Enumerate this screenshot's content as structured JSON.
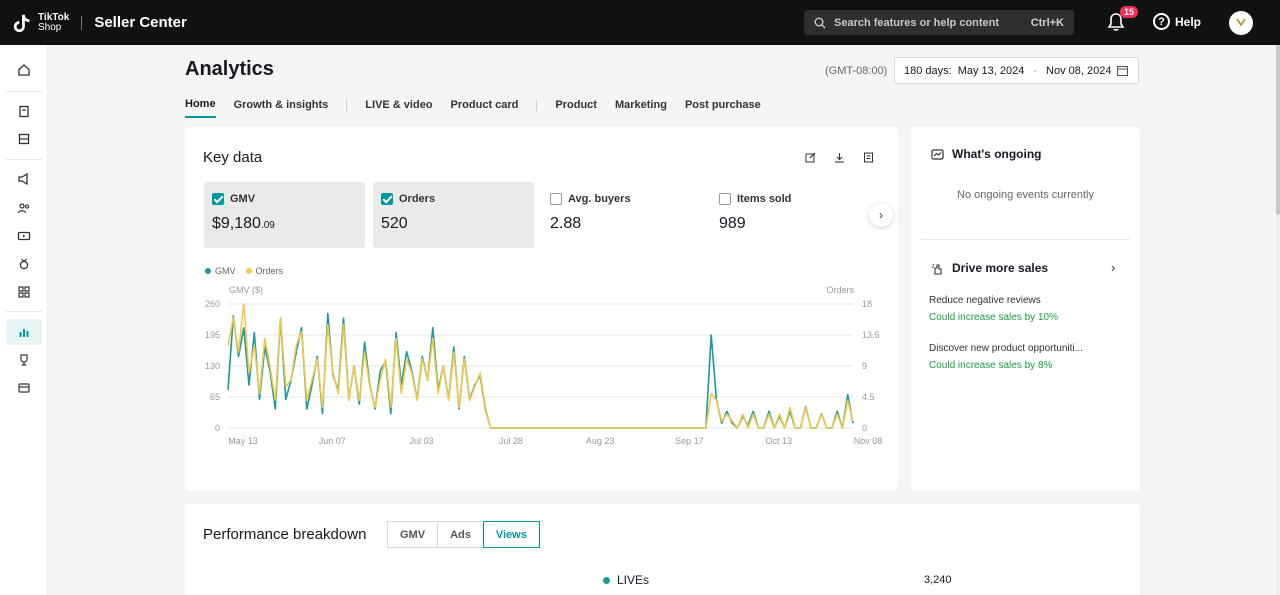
{
  "header": {
    "logo_line1": "TikTok",
    "logo_line2": "Shop",
    "app_title": "Seller Center",
    "search_placeholder": "Search features or help content",
    "search_shortcut": "Ctrl+K",
    "notification_count": "15",
    "help_label": "Help",
    "brand_color": "#111111"
  },
  "page": {
    "title": "Analytics",
    "timezone": "(GMT-08:00)",
    "date_range_label": "180 days:",
    "date_start": "May 13, 2024",
    "date_sep": "-",
    "date_end": "Nov 08, 2024"
  },
  "tabs": [
    "Home",
    "Growth & insights",
    "LIVE & video",
    "Product card",
    "Product",
    "Marketing",
    "Post purchase"
  ],
  "key_data": {
    "title": "Key data",
    "metrics": [
      {
        "label": "GMV",
        "value_main": "$9,180",
        "value_decimal": ".09",
        "checked": true
      },
      {
        "label": "Orders",
        "value_main": "520",
        "value_decimal": "",
        "checked": true
      },
      {
        "label": "Avg. buyers",
        "value_main": "2.88",
        "value_decimal": "",
        "checked": false
      },
      {
        "label": "Items sold",
        "value_main": "989",
        "value_decimal": "",
        "checked": false
      }
    ]
  },
  "chart_data": {
    "type": "line",
    "legend": [
      "GMV",
      "Orders"
    ],
    "left_axis_label": "GMV ($)",
    "right_axis_label": "Orders",
    "left_ticks": [
      "260",
      "195",
      "130",
      "65",
      "0"
    ],
    "right_ticks": [
      "18",
      "13.5",
      "9",
      "4.5",
      "0"
    ],
    "x_ticks": [
      "May 13",
      "Jun 07",
      "Jul 03",
      "Jul 28",
      "Aug 23",
      "Sep 17",
      "Oct 13",
      "Nov 08"
    ],
    "ylim_left": [
      0,
      260
    ],
    "ylim_right": [
      0,
      18
    ],
    "series": [
      {
        "name": "GMV",
        "color": "#1a9a9a",
        "axis": "left",
        "values": [
          80,
          235,
          150,
          210,
          90,
          200,
          60,
          170,
          120,
          40,
          230,
          60,
          100,
          160,
          210,
          40,
          90,
          150,
          30,
          240,
          110,
          80,
          230,
          60,
          130,
          50,
          180,
          90,
          40,
          120,
          140,
          30,
          200,
          90,
          160,
          120,
          60,
          150,
          100,
          210,
          80,
          130,
          60,
          170,
          40,
          150,
          60,
          90,
          110,
          40,
          0,
          0,
          0,
          0,
          0,
          0,
          0,
          0,
          0,
          0,
          0,
          0,
          0,
          0,
          0,
          0,
          0,
          0,
          0,
          0,
          0,
          0,
          0,
          0,
          0,
          0,
          0,
          0,
          0,
          0,
          0,
          0,
          0,
          0,
          0,
          0,
          0,
          0,
          0,
          0,
          0,
          0,
          195,
          60,
          10,
          35,
          10,
          0,
          25,
          5,
          35,
          0,
          0,
          35,
          0,
          25,
          0,
          35,
          0,
          0,
          45,
          0,
          0,
          30,
          0,
          0,
          35,
          0,
          70,
          10
        ]
      },
      {
        "name": "Orders",
        "color": "#f2c84b",
        "axis": "right",
        "values": [
          12,
          16,
          11,
          18,
          8,
          12,
          5,
          13,
          9,
          4,
          16,
          6,
          7,
          12,
          14,
          4,
          7,
          10,
          3,
          15,
          8,
          5,
          15,
          4,
          9,
          4,
          11,
          6,
          3,
          7,
          10,
          3,
          13,
          5,
          10,
          8,
          4,
          10,
          7,
          13,
          5,
          9,
          4,
          11,
          3,
          10,
          4,
          6,
          8,
          3,
          0,
          0,
          0,
          0,
          0,
          0,
          0,
          0,
          0,
          0,
          0,
          0,
          0,
          0,
          0,
          0,
          0,
          0,
          0,
          0,
          0,
          0,
          0,
          0,
          0,
          0,
          0,
          0,
          0,
          0,
          0,
          0,
          0,
          0,
          0,
          0,
          0,
          0,
          0,
          0,
          0,
          0,
          5,
          4,
          1,
          2,
          1,
          0,
          2,
          0,
          2,
          0,
          0,
          2,
          0,
          2,
          0,
          3,
          0,
          0,
          3,
          0,
          0,
          2,
          0,
          0,
          2,
          0,
          4,
          1
        ]
      }
    ]
  },
  "ongoing": {
    "title": "What's ongoing",
    "empty_text": "No ongoing events currently",
    "drive_title": "Drive more sales",
    "tips": [
      {
        "label": "Reduce negative reviews",
        "sub": "Could increase sales by 10%"
      },
      {
        "label": "Discover new product opportuniti...",
        "sub": "Could increase sales by 8%"
      }
    ],
    "accent_color": "#1c9e3c"
  },
  "performance": {
    "title": "Performance breakdown",
    "segments": [
      "GMV",
      "Ads",
      "Views"
    ],
    "active_segment": "Views",
    "row_label": "LIVEs",
    "row_value": "3,240"
  }
}
